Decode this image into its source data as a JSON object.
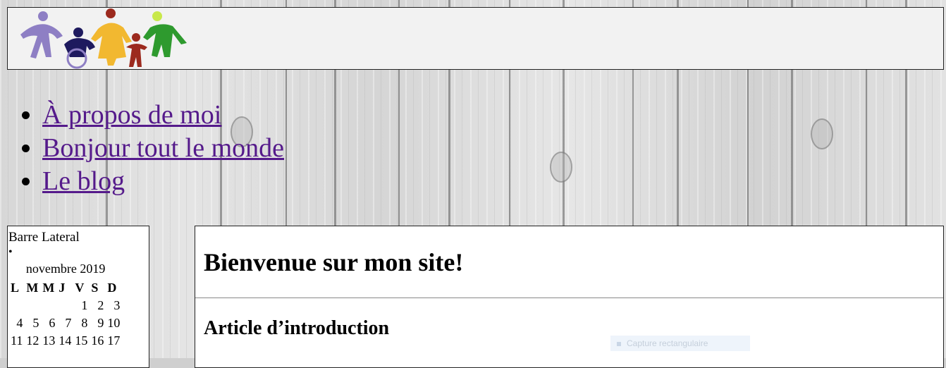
{
  "header": {
    "logo": {
      "icon": "family-figures-logo",
      "colors": [
        "#8e7fc4",
        "#1e1a5e",
        "#f2b830",
        "#9c2a1e",
        "#2e9a2e"
      ]
    }
  },
  "nav": {
    "items": [
      {
        "label": "À propos de moi"
      },
      {
        "label": "Bonjour tout le monde"
      },
      {
        "label": "Le blog"
      }
    ],
    "link_color": "#551a8b"
  },
  "sidebar": {
    "title": "Barre Lateral",
    "calendar": {
      "caption": "novembre 2019",
      "days": [
        "L",
        "M",
        "M",
        "J",
        "V",
        "S",
        "D"
      ],
      "rows": [
        [
          "",
          "",
          "",
          "",
          "1",
          "2",
          "3"
        ],
        [
          "4",
          "5",
          "6",
          "7",
          "8",
          "9",
          "10"
        ],
        [
          "11",
          "12",
          "13",
          "14",
          "15",
          "16",
          "17"
        ]
      ]
    }
  },
  "main": {
    "page_title": "Bienvenue sur mon site!",
    "article_title": "Article d’introduction"
  },
  "overlay": {
    "capture_label": "Capture rectangulaire"
  }
}
